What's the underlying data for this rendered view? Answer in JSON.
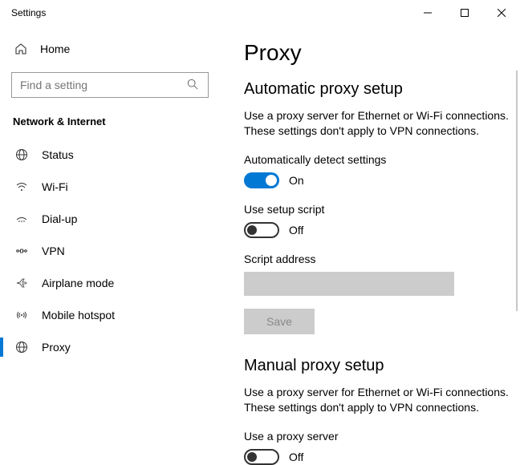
{
  "window": {
    "title": "Settings"
  },
  "sidebar": {
    "home": "Home",
    "search_placeholder": "Find a setting",
    "category": "Network & Internet",
    "items": [
      {
        "label": "Status"
      },
      {
        "label": "Wi-Fi"
      },
      {
        "label": "Dial-up"
      },
      {
        "label": "VPN"
      },
      {
        "label": "Airplane mode"
      },
      {
        "label": "Mobile hotspot"
      },
      {
        "label": "Proxy"
      }
    ]
  },
  "page": {
    "title": "Proxy",
    "auto": {
      "heading": "Automatic proxy setup",
      "desc": "Use a proxy server for Ethernet or Wi-Fi connections. These settings don't apply to VPN connections.",
      "detect_label": "Automatically detect settings",
      "detect_state": "On",
      "script_label": "Use setup script",
      "script_state": "Off",
      "script_addr_label": "Script address",
      "save": "Save"
    },
    "manual": {
      "heading": "Manual proxy setup",
      "desc": "Use a proxy server for Ethernet or Wi-Fi connections. These settings don't apply to VPN connections.",
      "use_label": "Use a proxy server",
      "use_state": "Off"
    }
  }
}
